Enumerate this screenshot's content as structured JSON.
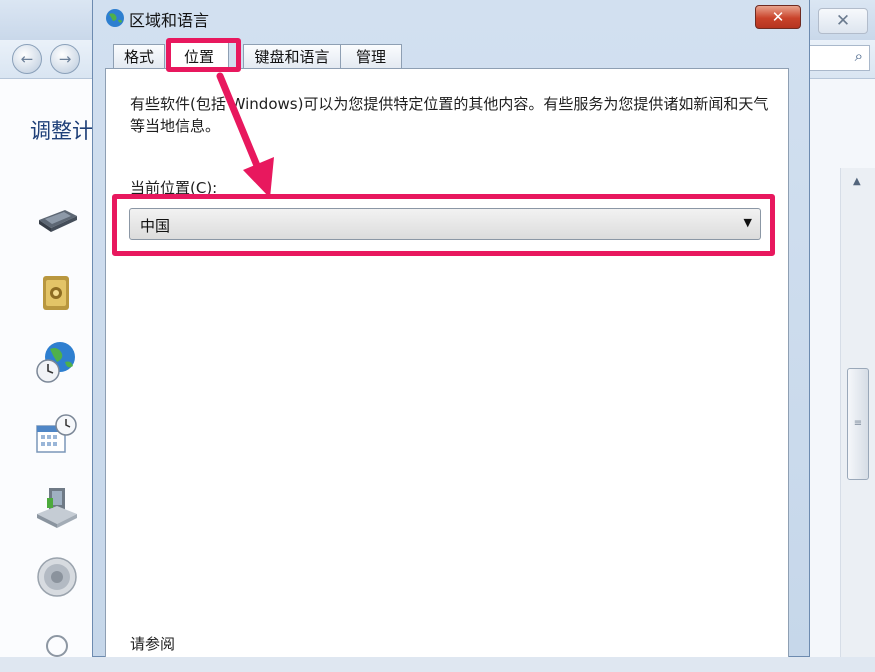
{
  "dialog": {
    "title": "区域和语言",
    "close_label": "✕",
    "tabs": [
      {
        "label": "格式"
      },
      {
        "label": "位置"
      },
      {
        "label": "键盘和语言"
      },
      {
        "label": "管理"
      }
    ],
    "active_tab": "位置",
    "description": "有些软件(包括 Windows)可以为您提供特定位置的其他内容。有些服务为您提供诸如新闻和天气等当地信息。",
    "current_location_label": "当前位置(C):",
    "current_location_value": "中国",
    "see_also_label": "请参阅"
  },
  "background_window": {
    "heading": "调整计",
    "close_label": "✕",
    "back_arrow": "←",
    "forward_arrow": "→",
    "search_icon": "⌕",
    "sidebar_icons": [
      "keyboard-icon",
      "safe-icon",
      "globe-clock-icon",
      "calendar-clock-icon",
      "backup-icon",
      "speaker-icon"
    ]
  },
  "annotations": {
    "highlight_color": "#e8185e"
  }
}
